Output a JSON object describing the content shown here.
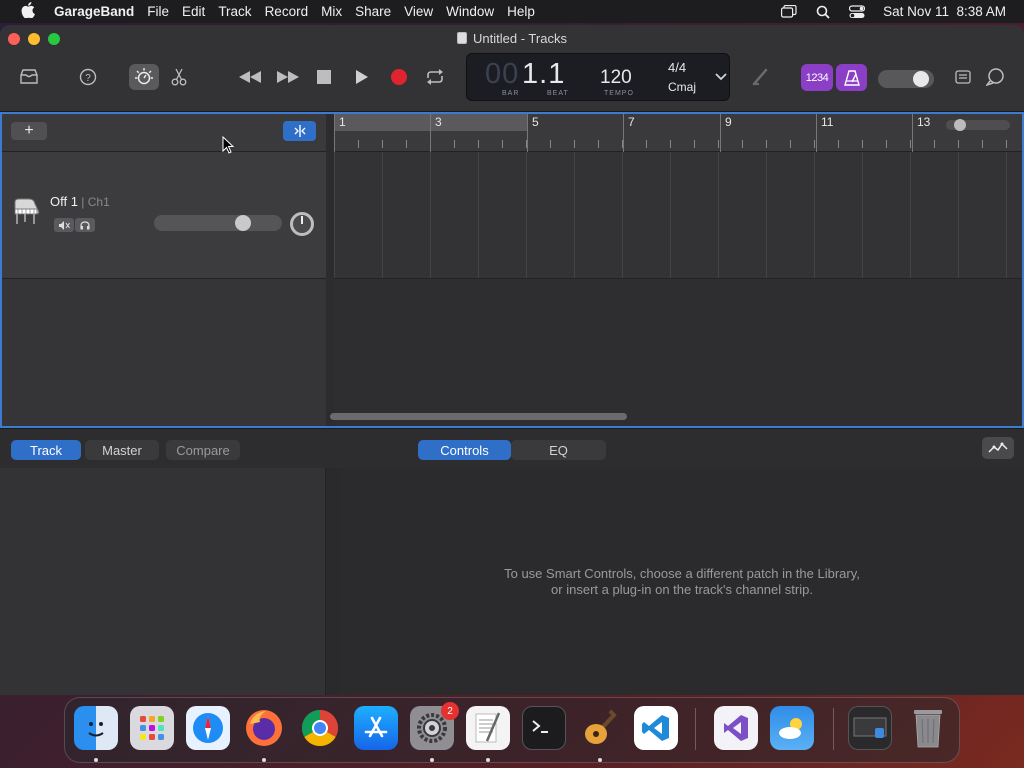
{
  "menubar": {
    "app": "GarageBand",
    "items": [
      "File",
      "Edit",
      "Track",
      "Record",
      "Mix",
      "Share",
      "View",
      "Window",
      "Help"
    ],
    "datetime": "Sat Nov 11  8:38 AM",
    "status_icons": [
      "screen-mirror-icon",
      "search-icon",
      "control-center-icon"
    ]
  },
  "window": {
    "title": "Untitled - Tracks"
  },
  "toolbar": {
    "icons": [
      "library-icon",
      "help-icon",
      "smart-controls-icon",
      "scissors-icon",
      "rewind-icon",
      "fast-forward-icon",
      "stop-icon",
      "play-icon",
      "record-icon",
      "cycle-icon",
      "tuner-icon",
      "count-in-icon",
      "metronome-icon",
      "notepad-icon",
      "loop-browser-icon"
    ],
    "lcd": {
      "bar_ghost": "00",
      "bar_value": "1.",
      "beat_value": "1",
      "bar_label": "BAR",
      "beat_label": "BEAT",
      "tempo": "120",
      "tempo_label": "TEMPO",
      "time_signature": "4/4",
      "key": "Cmaj"
    },
    "count_in_label": "1234"
  },
  "tracks": {
    "add_label": "+",
    "track": {
      "name": "Off 1",
      "channel": " | Ch1",
      "volume_fraction": 0.72
    },
    "ruler_bars": [
      "1",
      "3",
      "5",
      "7",
      "9",
      "11",
      "13"
    ]
  },
  "smart_controls": {
    "tabs_left": [
      "Track",
      "Master",
      "Compare"
    ],
    "tabs_center": [
      "Controls",
      "EQ"
    ],
    "message_line1": "To use Smart Controls, choose a different patch in the Library,",
    "message_line2": "or insert a plug-in on the track's channel strip."
  },
  "dock": {
    "apps": [
      "finder-icon",
      "launchpad-icon",
      "safari-icon",
      "firefox-icon",
      "chrome-icon",
      "app-store-icon",
      "system-settings-icon",
      "textedit-icon",
      "terminal-icon",
      "garageband-icon",
      "vscode-icon",
      "visual-studio-icon",
      "weather-icon",
      "screenshot-stack-icon",
      "trash-icon"
    ],
    "settings_badge": "2"
  },
  "colors": {
    "accent": "#2f6fc7",
    "record": "#e0242f",
    "purple": "#8b3fc7"
  }
}
